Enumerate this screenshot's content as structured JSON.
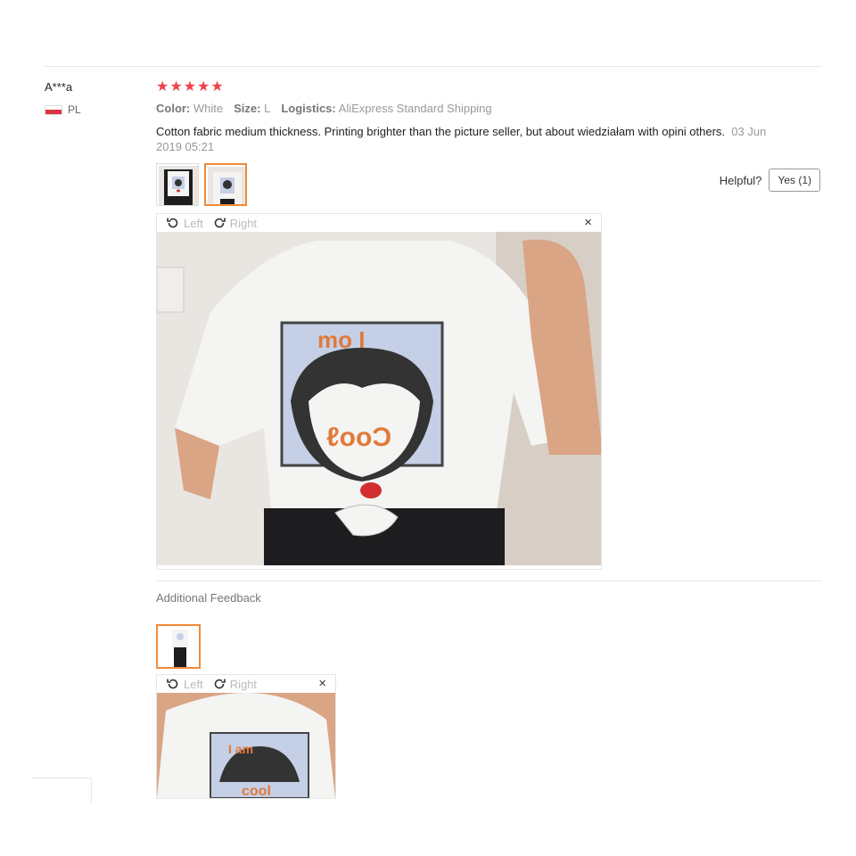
{
  "review": {
    "user": "A***a",
    "country": "PL",
    "rating": 5,
    "attributes": [
      {
        "label": "Color:",
        "value": "White"
      },
      {
        "label": "Size:",
        "value": "L"
      },
      {
        "label": "Logistics:",
        "value": "AliExpress Standard Shipping"
      }
    ],
    "text": "Cotton fabric medium thickness. Printing brighter than the picture seller, but about wiedziałam with opini others.",
    "date": "03 Jun 2019 05:21",
    "helpful_label": "Helpful?",
    "yes_label": "Yes (1)"
  },
  "viewer": {
    "left_label": "Left",
    "right_label": "Right",
    "close_glyph": "×"
  },
  "additional": {
    "title": "Additional Feedback"
  },
  "colors": {
    "star": "#f0424c",
    "accent": "#f08a3a",
    "flag_red": "#dc3545",
    "shirt": "#f4f4f2",
    "print_bg": "#c5cfe6",
    "print_text": "#e07a3a",
    "pants": "#1d1d1f",
    "wall": "#e9e6e2"
  },
  "icons": [
    "star-icon",
    "flag-pl-icon",
    "rotate-left-icon",
    "rotate-right-icon",
    "close-icon"
  ]
}
